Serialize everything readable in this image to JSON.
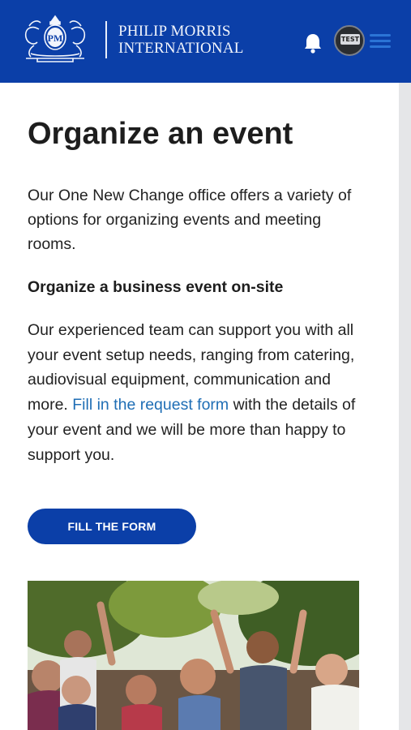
{
  "header": {
    "brand_line1": "PHILIP MORRIS",
    "brand_line2": "INTERNATIONAL",
    "crest_monogram": "PM",
    "avatar_label": "TEST",
    "icons": [
      "pmi-crest-logo",
      "bell-icon",
      "avatar",
      "menu-icon"
    ]
  },
  "page": {
    "title": "Organize an event",
    "intro": "Our One New Change office offers a variety of options for organizing events and meeting rooms.",
    "subheading": "Organize a business event on-site",
    "body_before_link": "Our experienced team can support you with all your event setup needs, ranging from catering, audiovisual equipment, communication and more. ",
    "body_link": "Fill in the request form",
    "body_after_link": " with the details of your event and we will be more than happy to support you.",
    "cta_label": "FILL THE FORM"
  },
  "colors": {
    "brand_blue": "#0b3fa8",
    "link_blue": "#1f6eb5",
    "scroll_track": "#e5e6e8"
  }
}
